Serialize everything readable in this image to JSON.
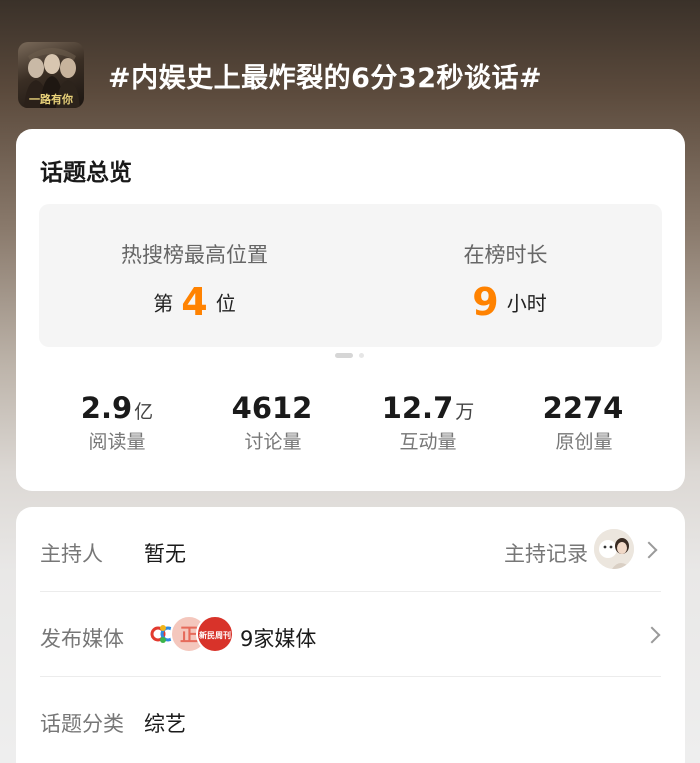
{
  "topic": {
    "title": "#内娱史上最炸裂的6分32秒谈话#",
    "cover_text": "一路有你"
  },
  "overview": {
    "title": "话题总览",
    "rank": {
      "label": "热搜榜最高位置",
      "prefix": "第",
      "value": "4",
      "suffix": "位"
    },
    "duration": {
      "label": "在榜时长",
      "value": "9",
      "suffix": "小时"
    },
    "stats": [
      {
        "value": "2.9",
        "unit": "亿",
        "label": "阅读量"
      },
      {
        "value": "4612",
        "unit": "",
        "label": "讨论量"
      },
      {
        "value": "12.7",
        "unit": "万",
        "label": "互动量"
      },
      {
        "value": "2274",
        "unit": "",
        "label": "原创量"
      }
    ]
  },
  "details": {
    "host": {
      "label": "主持人",
      "value": "暂无",
      "record_label": "主持记录"
    },
    "media": {
      "label": "发布媒体",
      "value": "9家媒体",
      "logo_texts": [
        "正",
        "新民周刊"
      ]
    },
    "category": {
      "label": "话题分类",
      "value": "综艺"
    }
  },
  "colors": {
    "accent": "#ff8200",
    "card_bg": "#ffffff",
    "rank_box_bg": "#f5f5f5"
  },
  "icons": [
    "chevron-right-icon",
    "chevron-right-icon"
  ]
}
